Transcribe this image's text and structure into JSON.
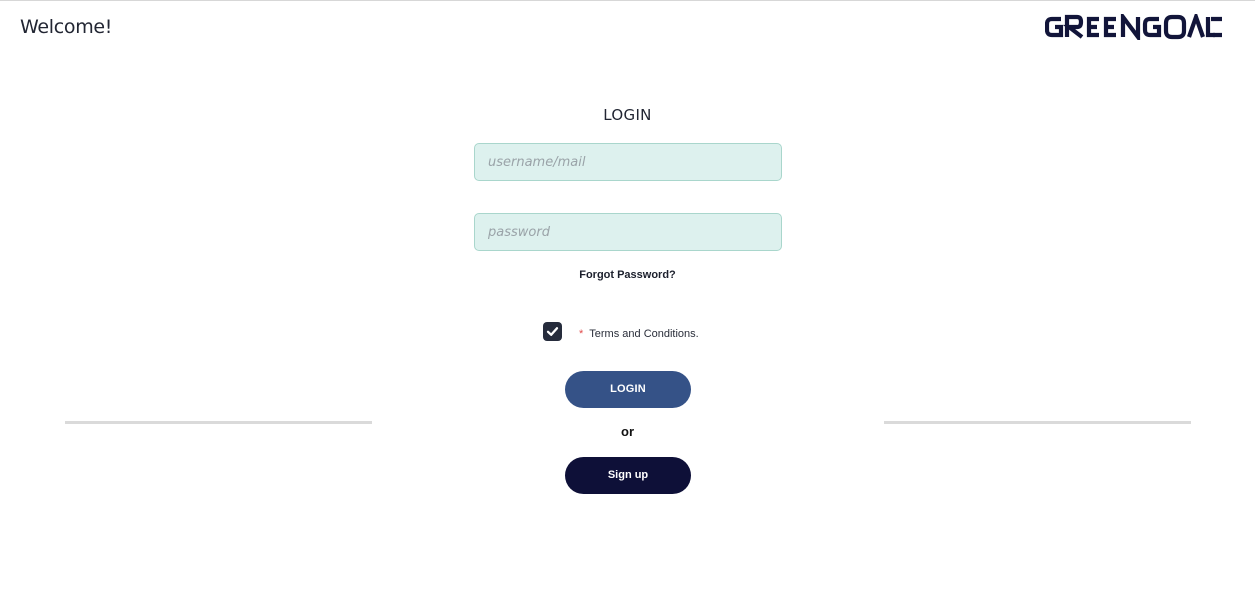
{
  "header": {
    "welcome": "Welcome!",
    "logo_text": "GREENGOALS"
  },
  "login": {
    "heading": "LOGIN",
    "username_placeholder": "username/mail",
    "password_placeholder": "password",
    "forgot_label": "Forgot Password?",
    "terms": {
      "required_marker": "*",
      "label": "Terms and Conditions.",
      "checked": true
    },
    "login_button_label": "LOGIN",
    "or_label": "or",
    "signup_button_label": "Sign up"
  },
  "colors": {
    "field_background": "#ddf1ee",
    "login_button": "#355287",
    "signup_button": "#0e1038",
    "logo": "#12153a",
    "required_marker": "#e14a4a"
  },
  "icons": {
    "checkbox": "check-icon"
  }
}
